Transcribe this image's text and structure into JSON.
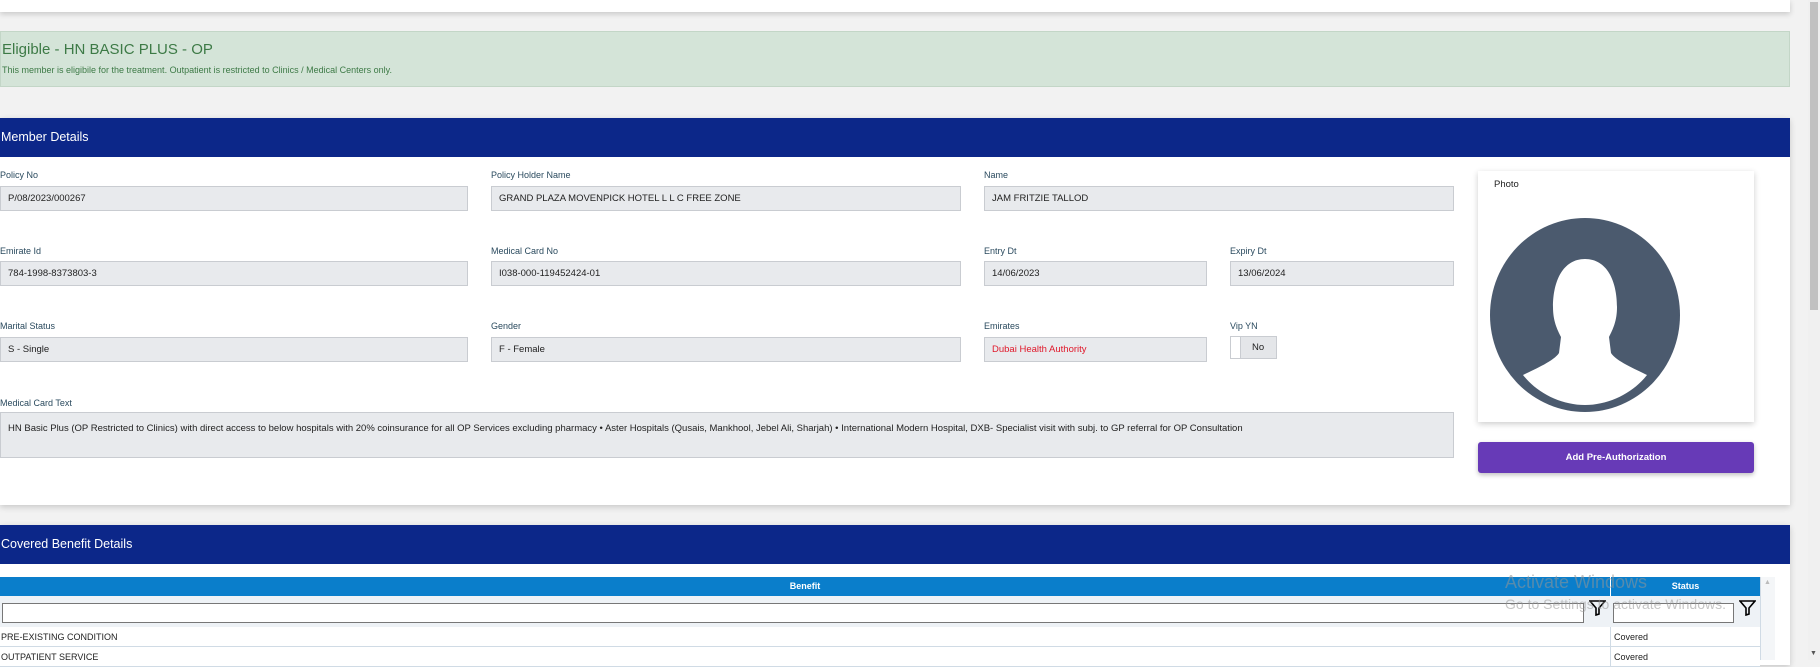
{
  "alert": {
    "title": "Eligible - HN BASIC PLUS - OP",
    "message": "This member is eligibile for the treatment. Outpatient is restricted to Clinics / Medical Centers only."
  },
  "member_details": {
    "title": "Member Details",
    "fields": {
      "policy_no": {
        "label": "Policy No",
        "value": "P/08/2023/000267"
      },
      "policy_holder_name": {
        "label": "Policy Holder Name",
        "value": "GRAND PLAZA MOVENPICK HOTEL L L C FREE ZONE"
      },
      "name": {
        "label": "Name",
        "value": "JAM FRITZIE TALLOD"
      },
      "emirate_id": {
        "label": "Emirate Id",
        "value": "784-1998-8373803-3"
      },
      "medical_card_no": {
        "label": "Medical Card No",
        "value": "I038-000-119452424-01"
      },
      "entry_dt": {
        "label": "Entry Dt",
        "value": "14/06/2023"
      },
      "expiry_dt": {
        "label": "Expiry Dt",
        "value": "13/06/2024"
      },
      "marital_status": {
        "label": "Marital Status",
        "value": "S - Single"
      },
      "gender": {
        "label": "Gender",
        "value": "F - Female"
      },
      "emirates": {
        "label": "Emirates",
        "value": "Dubai Health Authority",
        "color": "#e0182a"
      },
      "vip_yn": {
        "label": "Vip YN",
        "value": "No"
      },
      "medical_card_text": {
        "label": "Medical Card Text",
        "value": "HN Basic Plus (OP Restricted to Clinics) with direct  access to below hospitals with 20% coinsurance for all OP Services excluding pharmacy • Aster Hospitals (Qusais, Mankhool, Jebel Ali,  Sharjah) • International Modern Hospital, DXB- Specialist visit with subj. to GP referral for OP Consultation"
      }
    },
    "photo_label": "Photo",
    "add_preauth_label": "Add Pre-Authorization"
  },
  "covered_benefits": {
    "title": "Covered Benefit Details",
    "columns": [
      "Benefit",
      "Status"
    ],
    "rows": [
      {
        "benefit": "PRE-EXISTING CONDITION",
        "status": "Covered"
      },
      {
        "benefit": "OUTPATIENT SERVICE",
        "status": "Covered"
      }
    ]
  },
  "watermark": {
    "line1": "Activate Windows",
    "line2": "Go to Settings to activate Windows."
  },
  "colors": {
    "header": "#0c2789",
    "accent_button": "#673ab7",
    "grid_header": "#0a7ecb",
    "alert_bg": "#d4e4d8"
  }
}
